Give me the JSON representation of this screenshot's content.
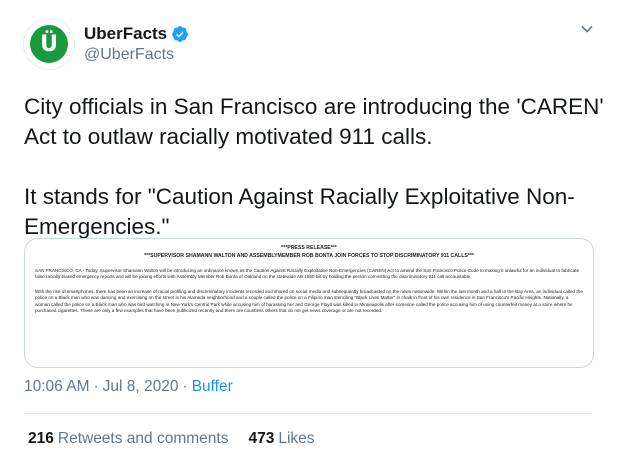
{
  "account": {
    "display_name": "UberFacts",
    "handle": "@UberFacts",
    "avatar_letter": "Ü",
    "avatar_color": "#1a9a3e",
    "verified_icon": "verified-badge-icon"
  },
  "tweet": {
    "paragraphs": [
      "City officials in San Francisco are introducing the 'CAREN' Act to outlaw racially motivated 911 calls.",
      "It stands for \"Caution Against Racially Exploitative Non-Emergencies.\""
    ]
  },
  "media": {
    "title": "***PRESS RELEASE***",
    "subtitle": "***SUPERVISOR SHAMANN WALTON AND ASSEMBLYMEMBER ROB BONTA JOIN FORCES TO STOP DISCRIMINATORY 911 CALLS***",
    "paragraph1": "SAN FRANCISCO, CA - Today, Supervisor Shamann Walton will be introducing an ordinance known as the Caution Against Racially Exploitative Non-Emergencies (CAREN) Act to amend the San Francisco Police Code to making it unlawful for an individual to fabricate false racially biased emergency reports and will be joining efforts with Assembly Member Rob Bonta of Oakland on the statewide AB 1550 bill by holding the person committing the discriminatory 911 call accountable.",
    "paragraph2": "With the rise of smartphones, there has been an increase of racial profiling and discriminatory incidents recorded and shared on social media and subsequently broadcasted on the news nationwide. Within the last month and a half in the Bay Area, an individual called the police on a Black man who was dancing and exercising on the street in his Alameda neighborhood and a couple called the police on a Filipino man stenciling \"Black Lives Matter\" in chalk in front of his own residence in San Francisco's Pacific Heights. Nationally, a woman called the police on a Black man who was bird watching in New York's Central Park while accusing him of harassing her and George Floyd was killed in Minneapolis after someone called the police accusing him of using counterfeit money at a store where he purchased cigarettes. These are only a few examples that have been publicized recently and there are countless others that do not get news coverage or are not recorded."
  },
  "meta": {
    "time": "10:06 AM",
    "separator": "·",
    "date": "Jul 8, 2020",
    "source": "Buffer"
  },
  "stats": {
    "retweets_count": "216",
    "retweets_label": "Retweets and comments",
    "likes_count": "473",
    "likes_label": "Likes"
  },
  "colors": {
    "link": "#1b95e0",
    "muted": "#657786",
    "text": "#14171a"
  }
}
